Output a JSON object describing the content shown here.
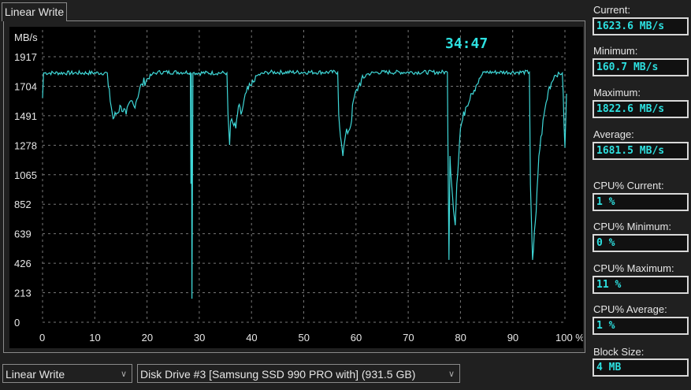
{
  "tab": {
    "label": "Linear Write"
  },
  "timer": "34:47",
  "stats": [
    {
      "label": "Current:",
      "value": "1623.6 MB/s"
    },
    {
      "label": "Minimum:",
      "value": "160.7 MB/s"
    },
    {
      "label": "Maximum:",
      "value": "1822.6 MB/s"
    },
    {
      "label": "Average:",
      "value": "1681.5 MB/s"
    },
    {
      "label": "CPU% Current:",
      "value": "1 %"
    },
    {
      "label": "CPU% Minimum:",
      "value": "0 %"
    },
    {
      "label": "CPU% Maximum:",
      "value": "11 %"
    },
    {
      "label": "CPU% Average:",
      "value": "1 %"
    },
    {
      "label": "Block Size:",
      "value": "4 MB"
    }
  ],
  "controls": {
    "test_select": "Linear Write",
    "drive_select": "Disk Drive #3  [Samsung SSD 990 PRO with]  (931.5 GB)"
  },
  "chart_data": {
    "type": "line",
    "ylabel": "MB/s",
    "xlabel": "%",
    "yticks": [
      0,
      213,
      426,
      639,
      852,
      1065,
      1278,
      1491,
      1704,
      1917
    ],
    "xticks": [
      "0",
      "10",
      "20",
      "30",
      "40",
      "50",
      "60",
      "70",
      "80",
      "90",
      "100 %"
    ],
    "ylim": [
      0,
      1917
    ],
    "xlim": [
      0,
      100
    ],
    "grid": true,
    "color": "#3fd8d8",
    "series": [
      [
        0,
        1620
      ],
      [
        0.2,
        1800
      ],
      [
        12.4,
        1800
      ],
      [
        12.6,
        1700
      ],
      [
        13.5,
        1470
      ],
      [
        15,
        1560
      ],
      [
        16,
        1500
      ],
      [
        17,
        1600
      ],
      [
        17.5,
        1560
      ],
      [
        19,
        1720
      ],
      [
        21,
        1790
      ],
      [
        22,
        1805
      ],
      [
        28.3,
        1805
      ],
      [
        28.4,
        1000
      ],
      [
        28.5,
        1800
      ],
      [
        28.6,
        170
      ],
      [
        28.8,
        1800
      ],
      [
        35.3,
        1800
      ],
      [
        35.5,
        1500
      ],
      [
        35.8,
        1280
      ],
      [
        36,
        1450
      ],
      [
        37,
        1400
      ],
      [
        37.5,
        1560
      ],
      [
        38,
        1500
      ],
      [
        39,
        1660
      ],
      [
        40,
        1710
      ],
      [
        41,
        1780
      ],
      [
        43,
        1805
      ],
      [
        56.5,
        1805
      ],
      [
        56.7,
        1500
      ],
      [
        57.2,
        1300
      ],
      [
        57.5,
        1200
      ],
      [
        58,
        1350
      ],
      [
        59,
        1420
      ],
      [
        59.5,
        1600
      ],
      [
        60.5,
        1710
      ],
      [
        62,
        1790
      ],
      [
        64,
        1805
      ],
      [
        77.5,
        1805
      ],
      [
        77.6,
        1300
      ],
      [
        77.8,
        450
      ],
      [
        78,
        1200
      ],
      [
        78.5,
        900
      ],
      [
        79,
        700
      ],
      [
        79.3,
        1000
      ],
      [
        80,
        1400
      ],
      [
        81,
        1550
      ],
      [
        82,
        1650
      ],
      [
        83,
        1710
      ],
      [
        84,
        1780
      ],
      [
        84.5,
        1805
      ],
      [
        93.2,
        1805
      ],
      [
        93.4,
        1000
      ],
      [
        93.8,
        450
      ],
      [
        94.5,
        800
      ],
      [
        95,
        1200
      ],
      [
        96,
        1500
      ],
      [
        97,
        1700
      ],
      [
        98,
        1780
      ],
      [
        99.5,
        1800
      ],
      [
        100,
        1260
      ],
      [
        100.3,
        1650
      ]
    ]
  }
}
